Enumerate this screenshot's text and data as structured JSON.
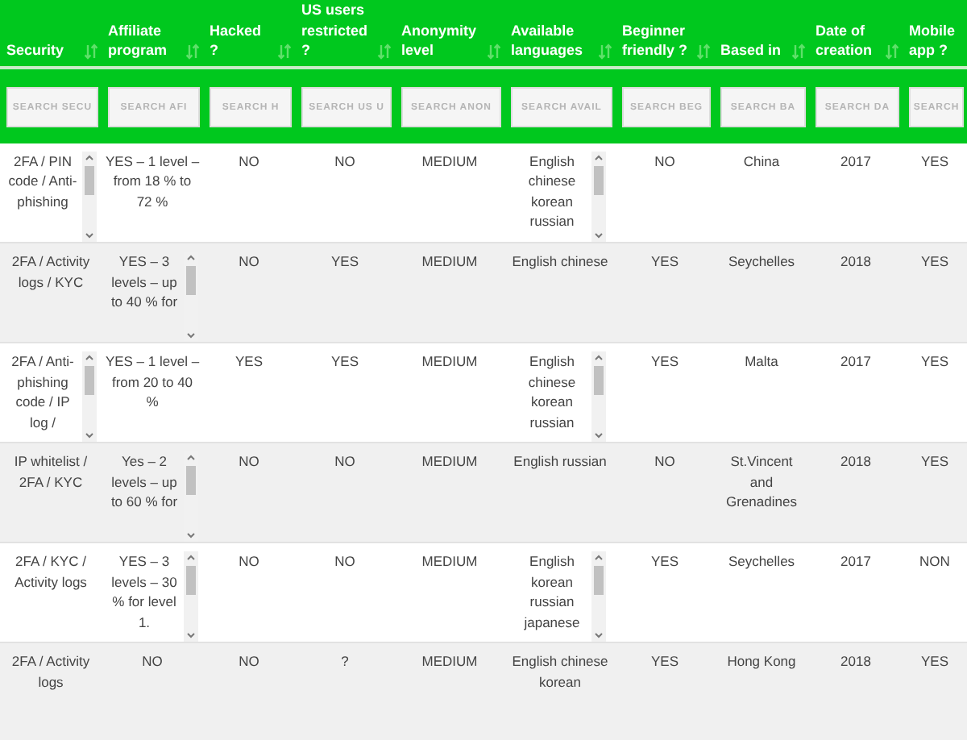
{
  "columns": [
    {
      "label": "Security",
      "search_placeholder": "SEARCH SECU"
    },
    {
      "label": "Affiliate program",
      "search_placeholder": "SEARCH AFI"
    },
    {
      "label": "Hacked ?",
      "search_placeholder": "SEARCH H"
    },
    {
      "label": "US users restricted ?",
      "search_placeholder": "SEARCH US U"
    },
    {
      "label": "Anonymity level",
      "search_placeholder": "SEARCH ANON"
    },
    {
      "label": "Available languages",
      "search_placeholder": "SEARCH AVAIL"
    },
    {
      "label": "Beginner friendly ?",
      "search_placeholder": "SEARCH BEG"
    },
    {
      "label": "Based in",
      "search_placeholder": "SEARCH BA"
    },
    {
      "label": "Date of creation",
      "search_placeholder": "SEARCH DA"
    },
    {
      "label": "Mobile app ?",
      "search_placeholder": "SEARCH"
    }
  ],
  "rows": [
    {
      "cells": [
        {
          "text": "2FA / PIN code / Anti-phishing",
          "scrollable": true
        },
        {
          "text": "YES – 1 level – from 18 % to 72 %",
          "scrollable": false
        },
        {
          "text": "NO",
          "scrollable": false
        },
        {
          "text": "NO",
          "scrollable": false
        },
        {
          "text": "MEDIUM",
          "scrollable": false
        },
        {
          "text": "English chinese korean russian",
          "scrollable": true
        },
        {
          "text": "NO",
          "scrollable": false
        },
        {
          "text": "China",
          "scrollable": false
        },
        {
          "text": "2017",
          "scrollable": false
        },
        {
          "text": "YES",
          "scrollable": false
        }
      ]
    },
    {
      "cells": [
        {
          "text": "2FA / Activity logs / KYC",
          "scrollable": false
        },
        {
          "text": "YES – 3 levels – up to 40 % for",
          "scrollable": true
        },
        {
          "text": "NO",
          "scrollable": false
        },
        {
          "text": "YES",
          "scrollable": false
        },
        {
          "text": "MEDIUM",
          "scrollable": false
        },
        {
          "text": "English chinese",
          "scrollable": false
        },
        {
          "text": "YES",
          "scrollable": false
        },
        {
          "text": "Seychelles",
          "scrollable": false
        },
        {
          "text": "2018",
          "scrollable": false
        },
        {
          "text": "YES",
          "scrollable": false
        }
      ]
    },
    {
      "cells": [
        {
          "text": "2FA / Anti-phishing code / IP log /",
          "scrollable": true
        },
        {
          "text": "YES – 1 level – from 20 to 40 %",
          "scrollable": false
        },
        {
          "text": "YES",
          "scrollable": false
        },
        {
          "text": "YES",
          "scrollable": false
        },
        {
          "text": "MEDIUM",
          "scrollable": false
        },
        {
          "text": "English chinese korean russian",
          "scrollable": true
        },
        {
          "text": "YES",
          "scrollable": false
        },
        {
          "text": "Malta",
          "scrollable": false
        },
        {
          "text": "2017",
          "scrollable": false
        },
        {
          "text": "YES",
          "scrollable": false
        }
      ]
    },
    {
      "cells": [
        {
          "text": "IP whitelist / 2FA / KYC",
          "scrollable": false
        },
        {
          "text": "Yes – 2 levels – up to 60 % for",
          "scrollable": true
        },
        {
          "text": "NO",
          "scrollable": false
        },
        {
          "text": "NO",
          "scrollable": false
        },
        {
          "text": "MEDIUM",
          "scrollable": false
        },
        {
          "text": "English russian",
          "scrollable": false
        },
        {
          "text": "NO",
          "scrollable": false
        },
        {
          "text": "St.Vincent and Grenadines",
          "scrollable": false
        },
        {
          "text": "2018",
          "scrollable": false
        },
        {
          "text": "YES",
          "scrollable": false
        }
      ]
    },
    {
      "cells": [
        {
          "text": "2FA / KYC / Activity logs",
          "scrollable": false
        },
        {
          "text": "YES – 3 levels – 30 % for level 1.",
          "scrollable": true
        },
        {
          "text": "NO",
          "scrollable": false
        },
        {
          "text": "NO",
          "scrollable": false
        },
        {
          "text": "MEDIUM",
          "scrollable": false
        },
        {
          "text": "English korean russian japanese",
          "scrollable": true
        },
        {
          "text": "YES",
          "scrollable": false
        },
        {
          "text": "Seychelles",
          "scrollable": false
        },
        {
          "text": "2017",
          "scrollable": false
        },
        {
          "text": "NON",
          "scrollable": false
        }
      ]
    },
    {
      "cells": [
        {
          "text": "2FA / Activity logs",
          "scrollable": false
        },
        {
          "text": "NO",
          "scrollable": false
        },
        {
          "text": "NO",
          "scrollable": false
        },
        {
          "text": "?",
          "scrollable": false
        },
        {
          "text": "MEDIUM",
          "scrollable": false
        },
        {
          "text": "English chinese korean",
          "scrollable": false
        },
        {
          "text": "YES",
          "scrollable": false
        },
        {
          "text": "Hong Kong",
          "scrollable": false
        },
        {
          "text": "2018",
          "scrollable": false
        },
        {
          "text": "YES",
          "scrollable": false
        }
      ]
    }
  ]
}
